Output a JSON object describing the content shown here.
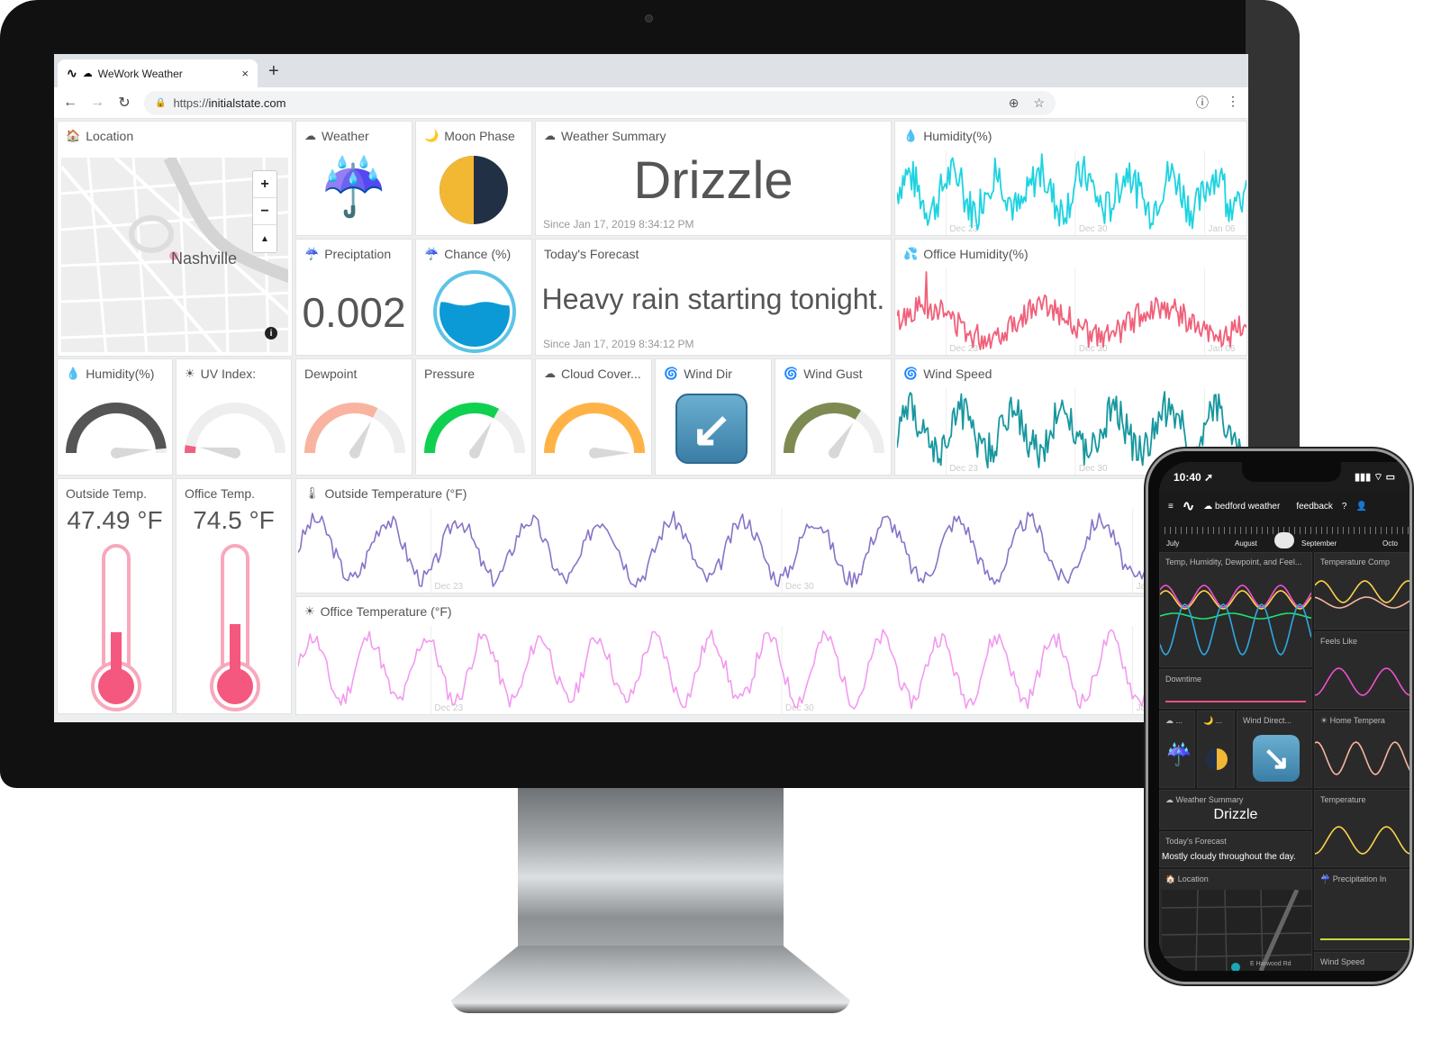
{
  "browser": {
    "tab": {
      "logo": "∿",
      "favicon": "cloud-icon",
      "title": "WeWork Weather",
      "close": "×"
    },
    "new_tab": "+",
    "nav": {
      "back": "←",
      "forward": "→",
      "reload": "↻"
    },
    "url": {
      "scheme": "https://",
      "host": "initialstate.com"
    },
    "omnibox_icons": {
      "zoom": "⊕",
      "star": "☆"
    },
    "right_icons": {
      "info": "ⓘ",
      "menu": "⋮"
    }
  },
  "dashboard": {
    "location": {
      "title": "Location",
      "icon": "🏠",
      "city": "Nashville",
      "zoom_in": "+",
      "zoom_out": "−",
      "compass": "▲",
      "info": "i"
    },
    "weather": {
      "title": "Weather",
      "icon": "☁",
      "value_icon": "☔"
    },
    "moon_phase": {
      "title": "Moon Phase",
      "icon": "🌙",
      "value_icon": "🌗"
    },
    "weather_summary": {
      "title": "Weather Summary",
      "icon": "☁",
      "value": "Drizzle",
      "since": "Since Jan 17, 2019 8:34:12 PM"
    },
    "humidity_chart": {
      "title": "Humidity(%)",
      "icon": "💧",
      "color": "#1dd3e0"
    },
    "precipitation": {
      "title": "Preciptation",
      "icon": "☔",
      "value": "0.002"
    },
    "chance": {
      "title": "Chance (%)",
      "icon": "☔",
      "fill_fraction": 0.6,
      "ring_color": "#5bc4e6",
      "fill_color": "#0b9ad6"
    },
    "todays_forecast": {
      "title": "Today's Forecast",
      "value": "Heavy rain starting tonight.",
      "since": "Since Jan 17, 2019 8:34:12 PM"
    },
    "office_humidity_chart": {
      "title": "Office Humidity(%)",
      "icon": "💦",
      "color": "#f0607a"
    },
    "gauges": [
      {
        "title": "Humidity(%)",
        "icon": "💧",
        "fraction": 0.97,
        "color": "#555555"
      },
      {
        "title": "UV Index:",
        "icon": "☀",
        "fraction": 0.05,
        "color": "#f06080"
      },
      {
        "title": "Dewpoint",
        "icon": "",
        "fraction": 0.65,
        "color": "#f8b4a0"
      },
      {
        "title": "Pressure",
        "icon": "",
        "fraction": 0.66,
        "color": "#10d050"
      },
      {
        "title": "Cloud Cover...",
        "icon": "☁",
        "fraction": 1.0,
        "color": "#ffb347"
      },
      {
        "title": "Wind Gust",
        "icon": "🌀",
        "fraction": 0.68,
        "color": "#7d8b52"
      }
    ],
    "wind_dir": {
      "title": "Wind Dir",
      "icon": "🌀",
      "value_icon": "↙"
    },
    "wind_speed_chart": {
      "title": "Wind Speed",
      "icon": "🌀",
      "color": "#17979e"
    },
    "outside_temp": {
      "title": "Outside Temp.",
      "value": "47.49 °F",
      "fill_fraction": 0.36
    },
    "office_temp": {
      "title": "Office Temp.",
      "value": "74.5 °F",
      "fill_fraction": 0.42
    },
    "outside_temp_chart": {
      "title": "Outside Temperature (°F)",
      "icon": "🌡",
      "color": "#8873c8"
    },
    "office_temp_chart": {
      "title": "Office Temperature (°F)",
      "icon": "☀",
      "color": "#f29af0"
    },
    "date_ticks": [
      "Dec 23",
      "Dec 30",
      "Jan 06"
    ]
  },
  "phone": {
    "time": "10:40 ➚",
    "status_right": "▮▮▮ ⌔ ▭",
    "menu_icon": "≡",
    "logo": "∿",
    "dashboard_name": "☁ bedford weather",
    "feedback": "feedback",
    "help": "?",
    "user": "👤",
    "timeline": [
      "July",
      "August",
      "September",
      "Octo"
    ],
    "tiles": {
      "combined": "Temp, Humidity, Dewpoint, and Feel...",
      "temp_comp": "Temperature Comp",
      "feels_like": "Feels Like",
      "downtime": "Downtime",
      "weather_short": "☁ ...",
      "moon_short": "🌙 ...",
      "wind_direct": "Wind Direct...",
      "home_temp": "☀ Home Tempera",
      "weather_summary": "☁ Weather Summary",
      "summary_value": "Drizzle",
      "temperature": "Temperature",
      "forecast_title": "Today's Forecast",
      "forecast_value": "Mostly cloudy throughout the day.",
      "location": "🏠 Location",
      "precipitation": "☔ Precipitation In",
      "wind_speed": "Wind Speed",
      "map_road": "E Harwood Rd"
    }
  }
}
